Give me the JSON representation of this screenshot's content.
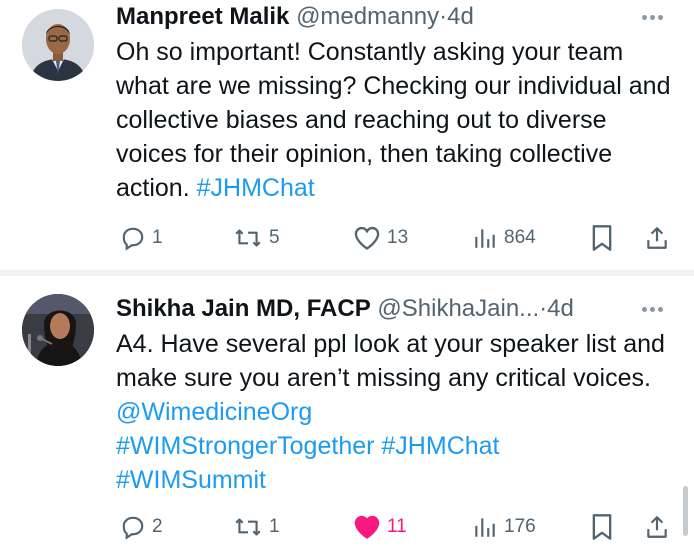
{
  "tweets": [
    {
      "name": "Manpreet Malik",
      "handle": "@medmanny",
      "dot": "·",
      "time": "4d",
      "body_text": "Oh so important! Constantly asking your team what are we missing? Checking our individual and collective biases and reaching out to diverse voices for their opinion, then taking collective action. ",
      "links": [
        "#JHMChat"
      ],
      "replies": "1",
      "reposts": "5",
      "likes": "13",
      "views": "864",
      "liked": false,
      "avatar": "headshot-photo"
    },
    {
      "name": "Shikha Jain MD, FACP",
      "handle": "@ShikhaJain...",
      "dot": "·",
      "time": "4d",
      "body_text": "A4. Have several ppl look at your speaker list and make sure you aren’t missing any critical voices.  ",
      "links": [
        "@WimedicineOrg",
        "#WIMStrongerTogether",
        "#JHMChat",
        "#WIMSummit"
      ],
      "replies": "2",
      "reposts": "1",
      "likes": "11",
      "views": "176",
      "liked": true,
      "avatar": "speaker-photo"
    }
  ],
  "colors": {
    "link": "#1d9bf0",
    "muted": "#536471",
    "like_active": "#f91880",
    "text": "#0f1419"
  }
}
